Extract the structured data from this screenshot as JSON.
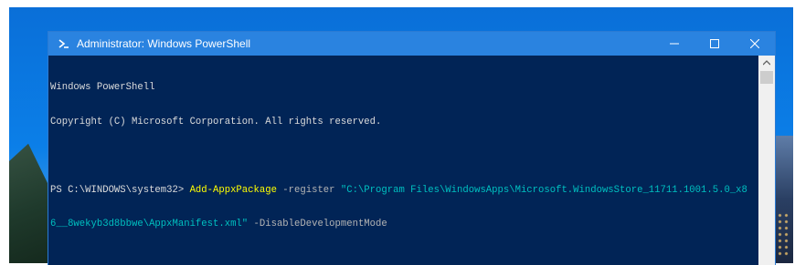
{
  "window": {
    "title": "Administrator: Windows PowerShell"
  },
  "console": {
    "line1": "Windows PowerShell",
    "line2": "Copyright (C) Microsoft Corporation. All rights reserved.",
    "prompt": "PS C:\\WINDOWS\\system32> ",
    "command": "Add-AppxPackage",
    "param1": " -register ",
    "path_part1": "\"C:\\Program Files\\WindowsApps\\Microsoft.WindowsStore_11711.1001.5.0_x8",
    "path_part2": "6__8wekyb3d8bbwe\\AppxManifest.xml\"",
    "param2": " -DisableDevelopmentMode"
  },
  "icons": {
    "app": "powershell-icon",
    "minimize": "minimize-icon",
    "maximize": "maximize-icon",
    "close": "close-icon",
    "scroll_up": "chevron-up-icon"
  },
  "colors": {
    "console_bg": "#012456",
    "titlebar_bg": "#2a83e0",
    "command_color": "#ffff00",
    "parameter_color": "#b4b4b4",
    "string_color": "#00c0c0"
  }
}
